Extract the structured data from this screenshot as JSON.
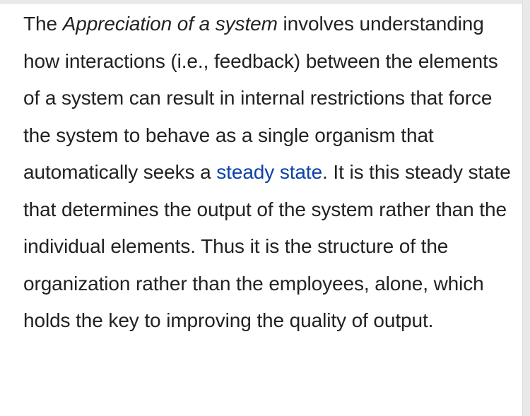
{
  "article": {
    "segments": {
      "s1": "The ",
      "s2": "Appreciation of a system",
      "s3": " involves understanding how interactions (i.e., feedback) between the elements of a system can result in internal restrictions that force the system to behave as a single organism that automatically seeks a ",
      "link": "steady state",
      "s4": ". It is this steady state that determines the output of the system rather than the individual elements. Thus it is the structure of the organization rather than the employees, alone, which holds the key to improving the quality of output."
    }
  },
  "colors": {
    "text": "#222222",
    "link": "#0b42a8",
    "background": "#ffffff"
  }
}
